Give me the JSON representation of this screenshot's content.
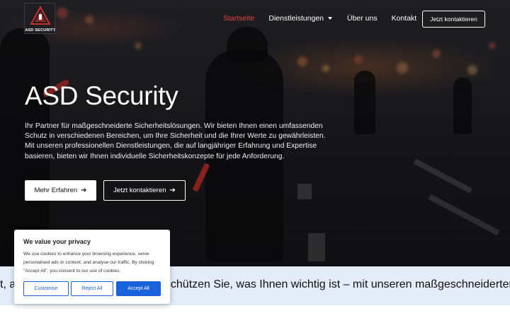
{
  "brand": {
    "logo_text": "ASD SECURITY"
  },
  "nav": {
    "items": [
      {
        "label": "Startseite",
        "active": true
      },
      {
        "label": "Dienstleistungen",
        "has_dropdown": true
      },
      {
        "label": "Über uns"
      },
      {
        "label": "Kontakt"
      }
    ],
    "cta_label": "Jetzt kontaktieren"
  },
  "hero": {
    "title": "ASD Security",
    "description": "Ihr Partner für maßgeschneiderte Sicherheitslösungen. Wir bieten Ihnen einen umfassenden Schutz in verschiedenen Bereichen, um Ihre Sicherheit und die Ihrer Werte zu gewährleisten. Mit unseren professionellen Dienstleistungen, die auf langjähriger Erfahrung und Expertise basieren, bieten wir Ihnen individuelle Sicherheitskonzepte für jede Anforderung.",
    "primary_button": "Mehr Erfahren",
    "secondary_button": "Jetzt kontaktieren"
  },
  "band": {
    "text_left": "t, a",
    "text_right": "Schützen Sie, was Ihnen wichtig ist – mit unseren maßgeschneiderten Sic"
  },
  "cookie": {
    "title": "We value your privacy",
    "text": "We use cookies to enhance your browsing experience, serve personalised ads or content, and analyse our traffic. By clicking \"Accept All\", you consent to our use of cookies.",
    "customise": "Customise",
    "reject": "Reject All",
    "accept": "Accept All"
  },
  "colors": {
    "accent": "#e8463c",
    "cookie_blue": "#1863dc",
    "band_bg": "#e3ecf8"
  },
  "icons": {
    "arrow": "arrow-right-icon",
    "caret": "chevron-down-icon"
  }
}
